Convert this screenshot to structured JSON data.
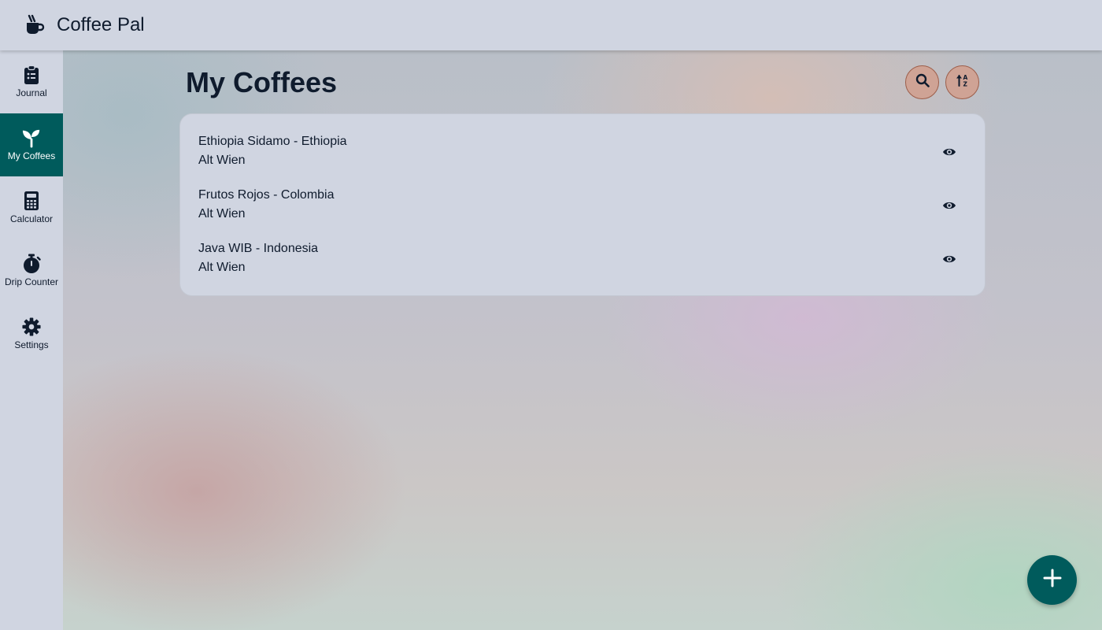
{
  "app": {
    "title": "Coffee Pal",
    "logo_icon": "coffee-mug-icon"
  },
  "sidebar": {
    "items": [
      {
        "label": "Journal",
        "icon": "clipboard-icon",
        "active": false
      },
      {
        "label": "My Coffees",
        "icon": "seedling-icon",
        "active": true
      },
      {
        "label": "Calculator",
        "icon": "calculator-icon",
        "active": false
      },
      {
        "label": "Drip Counter",
        "icon": "stopwatch-icon",
        "active": false
      },
      {
        "label": "Settings",
        "icon": "gear-icon",
        "active": false
      }
    ]
  },
  "main": {
    "title": "My Coffees",
    "actions": {
      "search_icon": "search-icon",
      "sort_icon": "sort-icon"
    },
    "coffees": [
      {
        "name": "Ethiopia Sidamo - Ethiopia",
        "roaster": "Alt Wien"
      },
      {
        "name": "Frutos Rojos - Colombia",
        "roaster": "Alt Wien"
      },
      {
        "name": "Java WIB - Indonesia",
        "roaster": "Alt Wien"
      }
    ]
  },
  "fab": {
    "icon": "plus-icon"
  },
  "colors": {
    "accent": "#005b5c",
    "surface": "#d0d5e1",
    "text": "#0f1b2d",
    "header_button": "#cfa395"
  }
}
